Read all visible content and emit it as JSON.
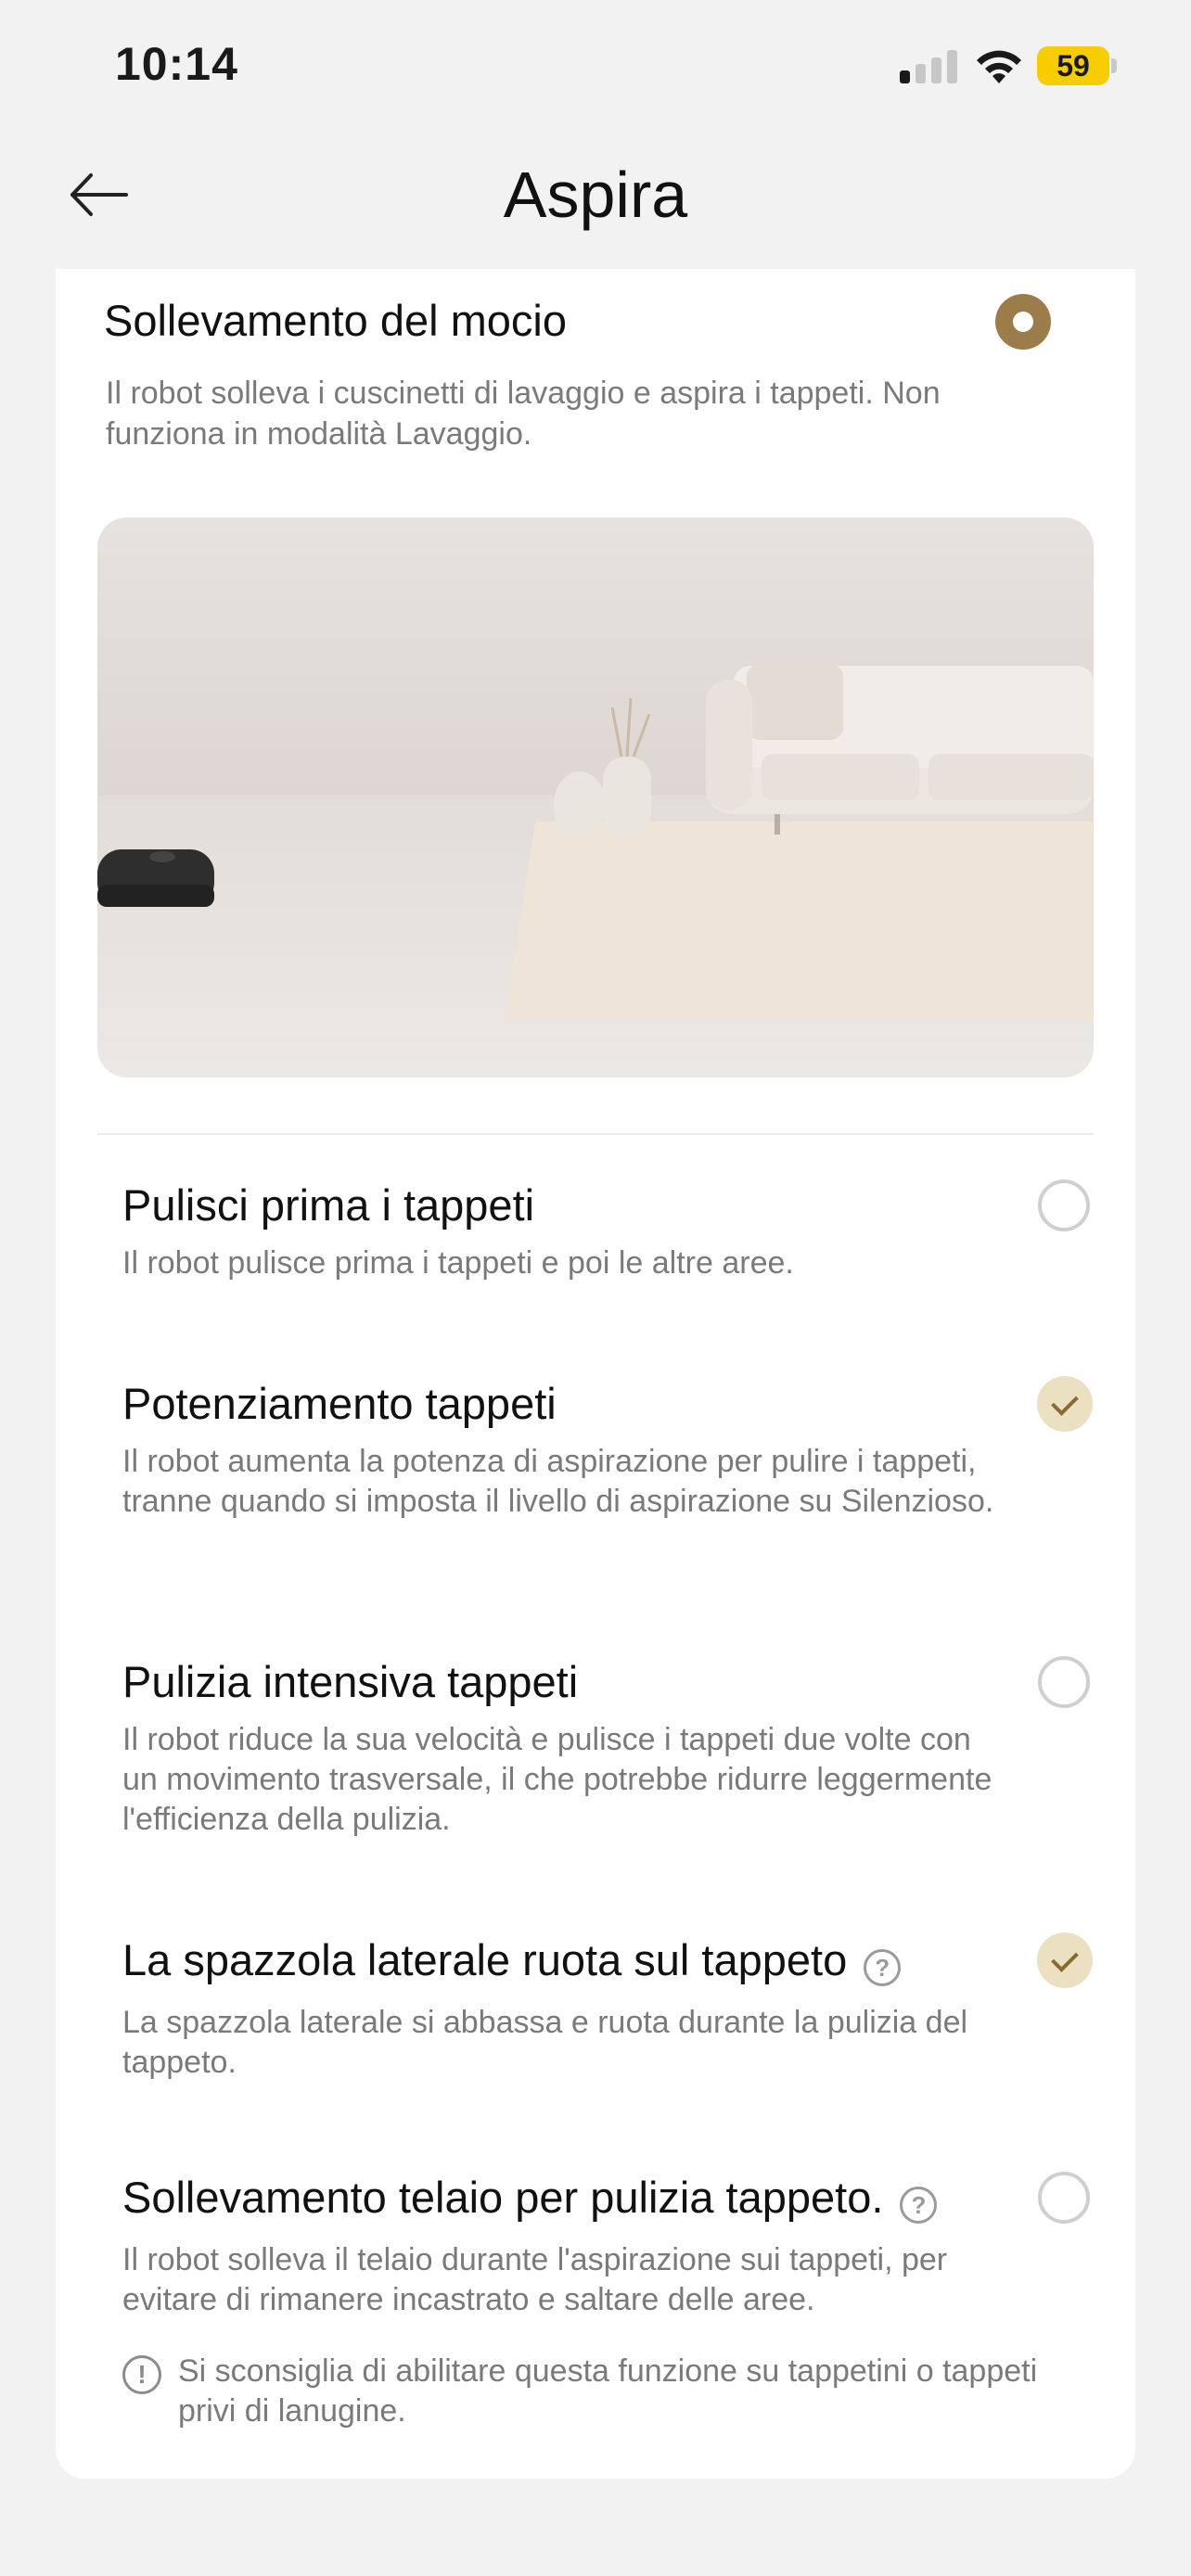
{
  "status_bar": {
    "time": "10:14",
    "battery": "59",
    "icons": [
      "signal-icon",
      "wifi-icon",
      "battery-icon"
    ]
  },
  "header": {
    "title": "Aspira",
    "back_icon": "arrow-left-icon"
  },
  "mop_lift": {
    "title": "Sollevamento del mocio",
    "description": "Il robot solleva i cuscinetti di lavaggio e aspira i tappeti. Non funziona in modalità Lavaggio.",
    "selected": true
  },
  "options": [
    {
      "title": "Pulisci prima i tappeti",
      "description": "Il robot pulisce prima i tappeti e poi le altre aree.",
      "checked": false,
      "help": false
    },
    {
      "title": "Potenziamento tappeti",
      "description": "Il robot aumenta la potenza di aspirazione per pulire i tappeti, tranne quando si imposta il livello di aspirazione su Silenzioso.",
      "checked": true,
      "help": false
    },
    {
      "title": "Pulizia intensiva tappeti",
      "description": "Il robot riduce la sua velocità e pulisce i tappeti due volte con un movimento trasversale, il che potrebbe ridurre leggermente l'efficienza della pulizia.",
      "checked": false,
      "help": false
    },
    {
      "title": "La spazzola laterale ruota sul tappeto",
      "description": "La spazzola laterale si abbassa e ruota durante la pulizia del tappeto.",
      "checked": true,
      "help": true
    },
    {
      "title": "Sollevamento telaio per pulizia tappeto.",
      "description": "Il robot solleva il telaio durante l'aspirazione sui tappeti, per evitare di rimanere incastrato e saltare delle aree.",
      "checked": false,
      "help": true
    }
  ],
  "warning": {
    "icon": "exclamation-circle-icon",
    "text": "Si sconsiglia di abilitare questa funzione su tappetini o tappeti privi di lanugine."
  },
  "help_glyph": "?",
  "warning_glyph": "!",
  "colors": {
    "accent": "#9c7c4b",
    "check_bg": "#ece0c2",
    "battery": "#f5cd00"
  }
}
